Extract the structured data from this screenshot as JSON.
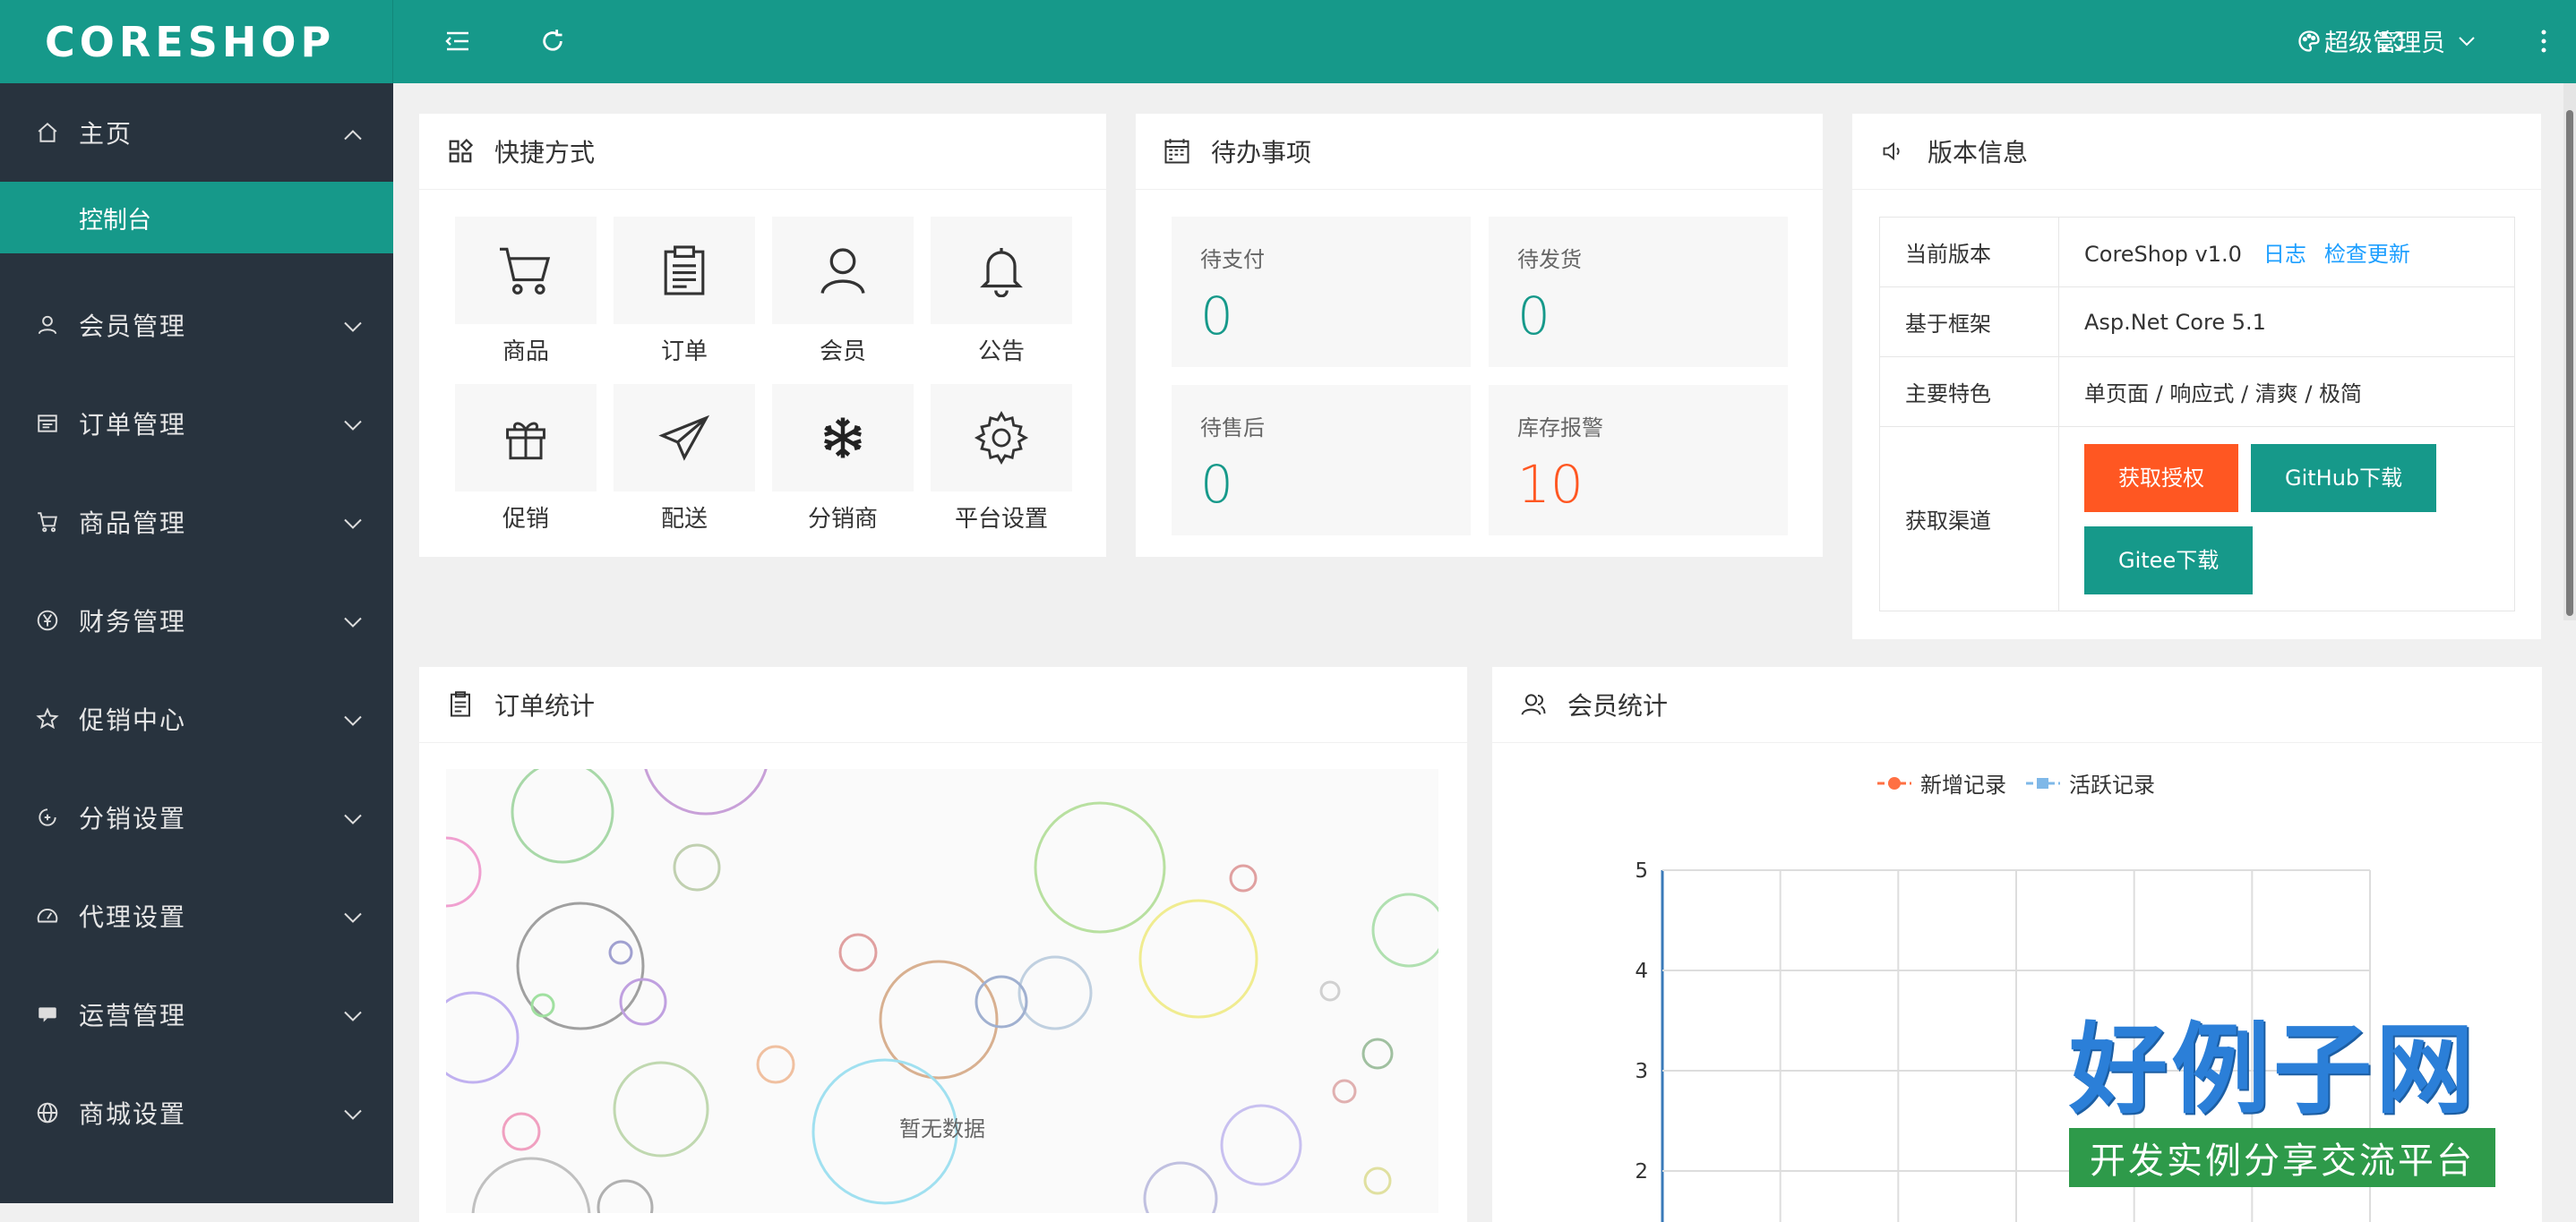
{
  "app": {
    "logo": "CORESHOP"
  },
  "sidebar": {
    "items": [
      {
        "label": "主页",
        "icon": "home-icon",
        "expanded": true,
        "sub": [
          {
            "label": "控制台",
            "active": true
          }
        ]
      },
      {
        "label": "会员管理",
        "icon": "user-icon"
      },
      {
        "label": "订单管理",
        "icon": "order-icon"
      },
      {
        "label": "商品管理",
        "icon": "cart-icon"
      },
      {
        "label": "财务管理",
        "icon": "yen-icon"
      },
      {
        "label": "促销中心",
        "icon": "star-icon"
      },
      {
        "label": "分销设置",
        "icon": "refresh-circle-icon"
      },
      {
        "label": "代理设置",
        "icon": "gauge-icon"
      },
      {
        "label": "运营管理",
        "icon": "chat-icon"
      },
      {
        "label": "商城设置",
        "icon": "globe-icon"
      }
    ]
  },
  "header": {
    "user": "超级管理员"
  },
  "shortcuts": {
    "title": "快捷方式",
    "items": [
      {
        "label": "商品",
        "icon": "cart-icon"
      },
      {
        "label": "订单",
        "icon": "clipboard-icon"
      },
      {
        "label": "会员",
        "icon": "user-icon"
      },
      {
        "label": "公告",
        "icon": "bell-icon"
      },
      {
        "label": "促销",
        "icon": "gift-icon"
      },
      {
        "label": "配送",
        "icon": "paper-plane-icon"
      },
      {
        "label": "分销商",
        "icon": "snowflake-icon"
      },
      {
        "label": "平台设置",
        "icon": "gear-icon"
      }
    ]
  },
  "todo": {
    "title": "待办事项",
    "items": [
      {
        "label": "待支付",
        "value": "0"
      },
      {
        "label": "待发货",
        "value": "0"
      },
      {
        "label": "待售后",
        "value": "0"
      },
      {
        "label": "库存报警",
        "value": "10"
      }
    ]
  },
  "version": {
    "title": "版本信息",
    "rows": [
      {
        "key": "当前版本",
        "value": "CoreShop v1.0",
        "links": [
          "日志",
          "检查更新"
        ]
      },
      {
        "key": "基于框架",
        "value": "Asp.Net Core 5.1"
      },
      {
        "key": "主要特色",
        "value": "单页面 / 响应式 / 清爽 / 极简"
      },
      {
        "key": "获取渠道",
        "buttons": [
          "获取授权",
          "GitHub下载",
          "Gitee下载"
        ]
      }
    ]
  },
  "order_stats": {
    "title": "订单统计",
    "empty_text": "暂无数据"
  },
  "member_stats": {
    "title": "会员统计",
    "legend": [
      "新增记录",
      "活跃记录"
    ]
  },
  "chart_data": {
    "type": "line",
    "series": [
      {
        "name": "新增记录",
        "values": []
      },
      {
        "name": "活跃记录",
        "values": []
      }
    ],
    "y_ticks": [
      2,
      3,
      4,
      5
    ],
    "grid": true,
    "legend_position": "top-center",
    "colors": {
      "new": "#ff7043",
      "active": "#7fb8e8"
    }
  },
  "watermark": {
    "big": "好例子网",
    "small": "开发实例分享交流平台"
  },
  "theme": {
    "primary": "#16998a",
    "sidebar": "#28333e",
    "warn": "#ff5722",
    "link": "#1e9fff"
  }
}
